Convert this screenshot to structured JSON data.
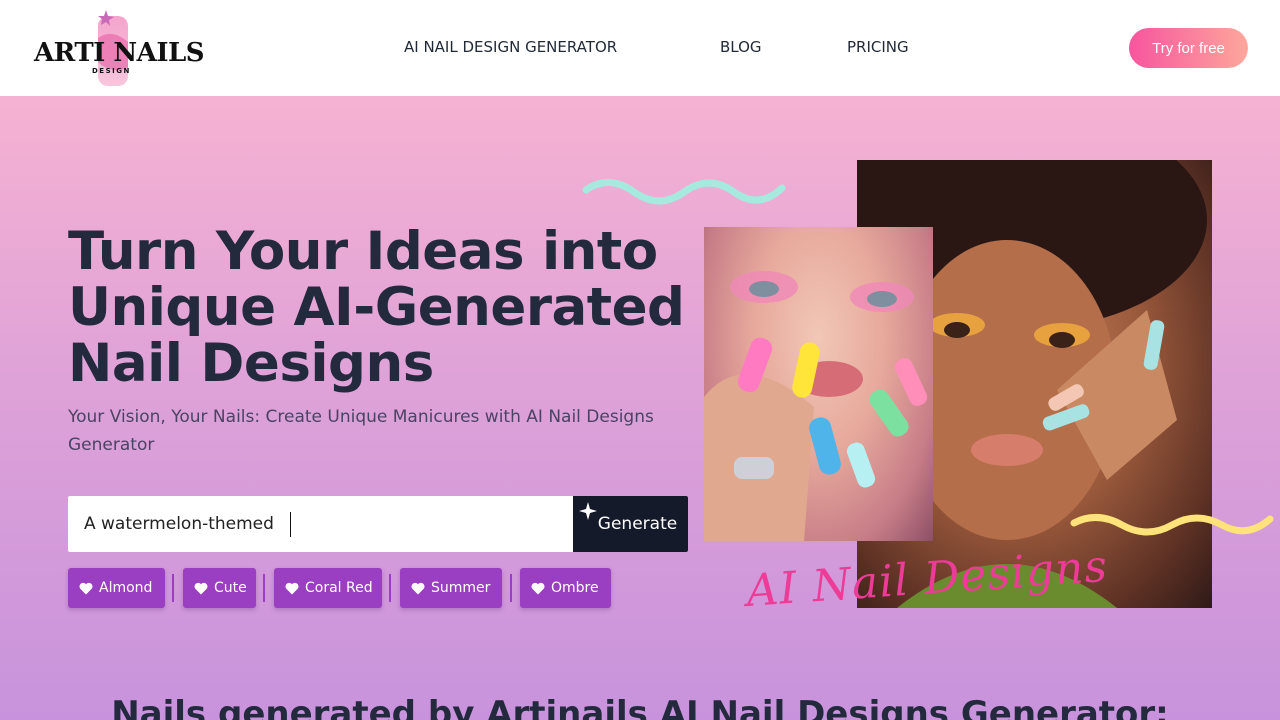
{
  "brand": {
    "logo_word": "ARTI NAILS",
    "logo_sub": "DESIGN",
    "accent": "#f7559e"
  },
  "nav": {
    "items": [
      {
        "label": "AI NAIL DESIGN GENERATOR"
      },
      {
        "label": "BLOG"
      },
      {
        "label": "PRICING"
      }
    ],
    "cta_label": "Try for free"
  },
  "hero": {
    "headline": "Turn Your Ideas into Unique AI-Generated Nail Designs",
    "subtitle": "Your Vision, Your Nails: Create Unique Manicures with AI Nail Designs Generator",
    "search": {
      "value": "A watermelon-themed",
      "generate_label": "Generate"
    },
    "tags": [
      {
        "label": "Almond"
      },
      {
        "label": "Cute"
      },
      {
        "label": "Coral Red"
      },
      {
        "label": "Summer"
      },
      {
        "label": "Ombre"
      }
    ],
    "overlay_text": "AI Nail Designs",
    "icons": {
      "tag_icon": "heart-icon",
      "generate_icon": "sparkle-icon"
    }
  },
  "section": {
    "title": "Nails generated by Artinails AI Nail Designs Generator:"
  }
}
